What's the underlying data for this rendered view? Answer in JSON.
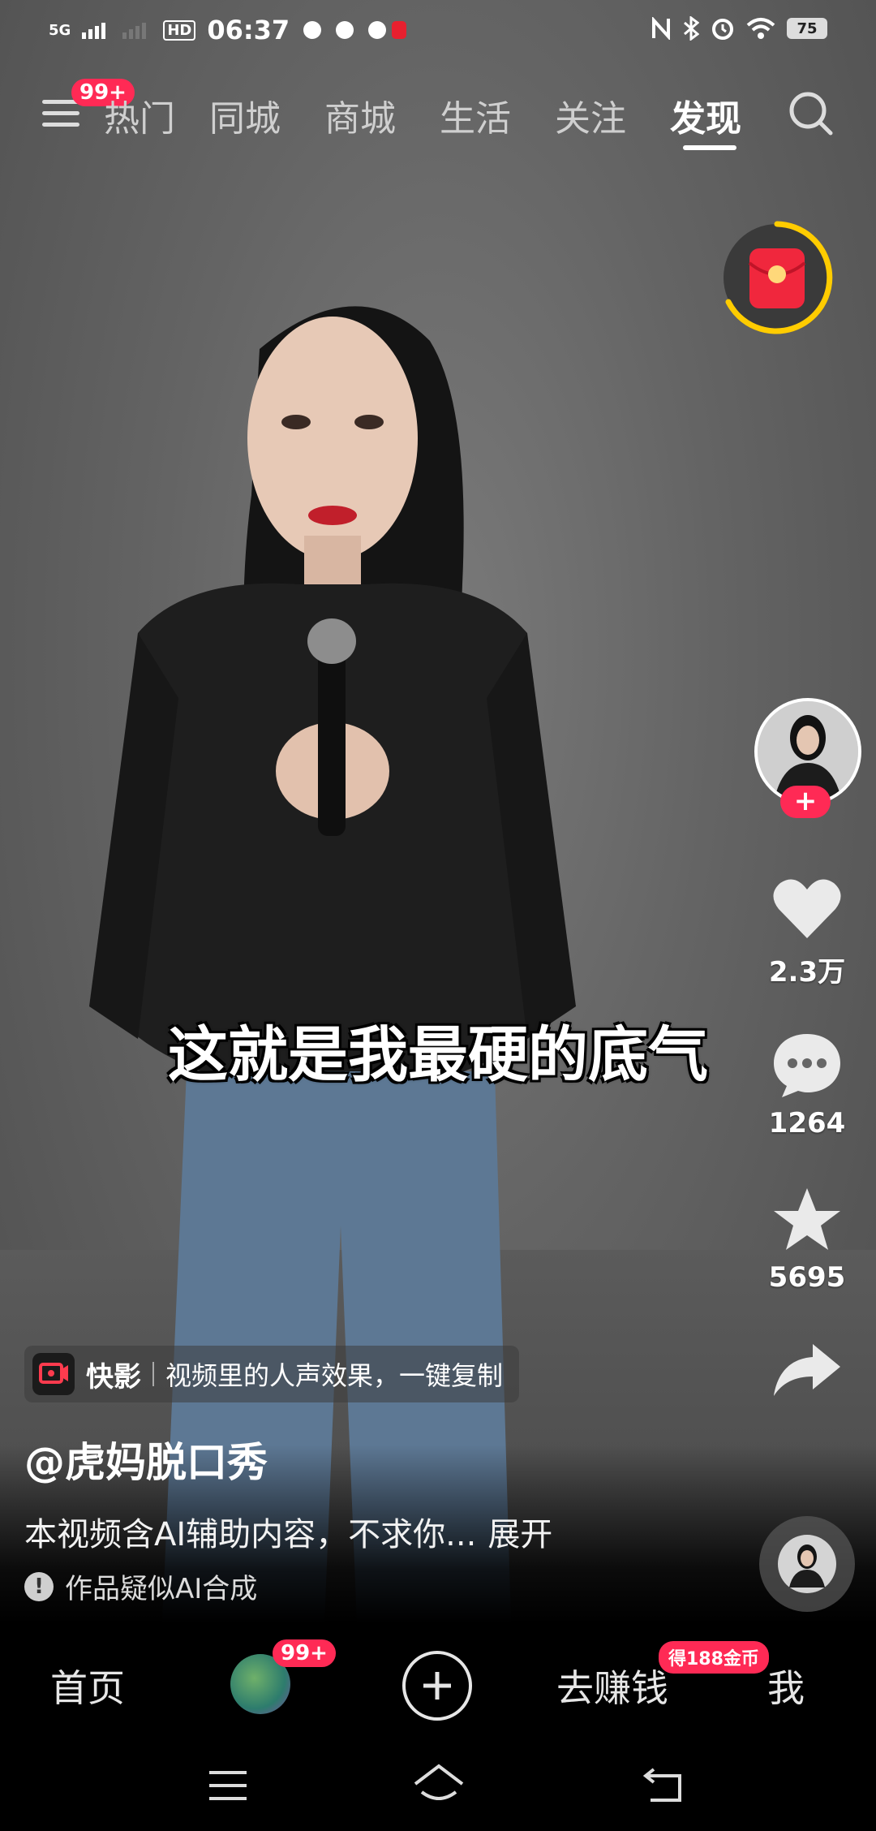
{
  "status_bar": {
    "network": "5G",
    "hd": "HD",
    "time": "06:37",
    "battery": "75"
  },
  "top_nav": {
    "menu_badge": "99+",
    "tabs": [
      "热门",
      "同城",
      "商城",
      "生活",
      "关注",
      "发现"
    ],
    "active_tab": "发现"
  },
  "video": {
    "caption": "这就是我最硬的底气"
  },
  "actions": {
    "follow": "+",
    "likes": "2.3万",
    "comments": "1264",
    "favorites": "5695"
  },
  "info": {
    "app_name": "快影",
    "app_promo": "视频里的人声效果，一键复制",
    "author": "@虎妈脱口秀",
    "description": "本视频含AI辅助内容，不求你...",
    "expand": "展开",
    "ai_note": "作品疑似AI合成"
  },
  "bottom_nav": {
    "home": "首页",
    "friends_badge": "99+",
    "earn": "去赚钱",
    "earn_badge": "得188金币",
    "me": "我"
  },
  "colors": {
    "accent": "#ff2a55",
    "ring": "#ffcc00"
  }
}
